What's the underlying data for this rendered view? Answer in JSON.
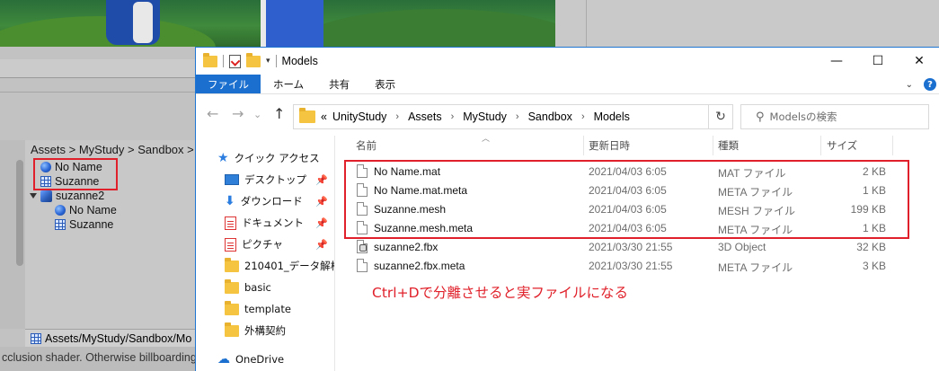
{
  "unity": {
    "breadcrumb": "Assets > MyStudy > Sandbox >",
    "tree": [
      {
        "label": "No Name",
        "icon": "material-sphere-icon"
      },
      {
        "label": "Suzanne",
        "icon": "mesh-grid-icon"
      },
      {
        "label": "suzanne2",
        "icon": "prefab-cube-icon"
      },
      {
        "label": "No Name",
        "icon": "material-sphere-icon"
      },
      {
        "label": "Suzanne",
        "icon": "mesh-grid-icon"
      }
    ],
    "path_bar": "Assets/MyStudy/Sandbox/Mo",
    "status_text": "cclusion shader. Otherwise billboarding"
  },
  "explorer": {
    "title": "Models",
    "ribbon_tabs": [
      "ファイル",
      "ホーム",
      "共有",
      "表示"
    ],
    "help": "?",
    "address_parts": [
      "UnityStudy",
      "Assets",
      "MyStudy",
      "Sandbox",
      "Models"
    ],
    "address_prefix": "«",
    "search_placeholder": "Modelsの検索",
    "columns": {
      "name": "名前",
      "date": "更新日時",
      "type": "種類",
      "size": "サイズ"
    },
    "nav": [
      {
        "label": "クイック アクセス",
        "icon": "star-icon",
        "pinned": false
      },
      {
        "label": "デスクトップ",
        "icon": "desktop-icon",
        "pinned": true
      },
      {
        "label": "ダウンロード",
        "icon": "download-icon",
        "pinned": true
      },
      {
        "label": "ドキュメント",
        "icon": "documents-icon",
        "pinned": true
      },
      {
        "label": "ピクチャ",
        "icon": "pictures-icon",
        "pinned": true
      },
      {
        "label": "210401_データ解析",
        "icon": "folder-icon",
        "pinned": false
      },
      {
        "label": "basic",
        "icon": "folder-icon",
        "pinned": false
      },
      {
        "label": "template",
        "icon": "folder-icon",
        "pinned": false
      },
      {
        "label": "外構契約",
        "icon": "folder-icon",
        "pinned": false
      },
      {
        "label": "OneDrive",
        "icon": "cloud-icon",
        "pinned": false
      }
    ],
    "files": [
      {
        "name": "No Name.mat",
        "date": "2021/04/03 6:05",
        "type": "MAT ファイル",
        "size": "2 KB"
      },
      {
        "name": "No Name.mat.meta",
        "date": "2021/04/03 6:05",
        "type": "META ファイル",
        "size": "1 KB"
      },
      {
        "name": "Suzanne.mesh",
        "date": "2021/04/03 6:05",
        "type": "MESH ファイル",
        "size": "199 KB"
      },
      {
        "name": "Suzanne.mesh.meta",
        "date": "2021/04/03 6:05",
        "type": "META ファイル",
        "size": "1 KB"
      },
      {
        "name": "suzanne2.fbx",
        "date": "2021/03/30 21:55",
        "type": "3D Object",
        "size": "32 KB"
      },
      {
        "name": "suzanne2.fbx.meta",
        "date": "2021/03/30 21:55",
        "type": "META ファイル",
        "size": "3 KB"
      }
    ]
  },
  "annotation": "Ctrl+Dで分離させると実ファイルになる",
  "colors": {
    "highlight_red": "#e0202a",
    "ribbon_blue": "#1a6fcf"
  }
}
